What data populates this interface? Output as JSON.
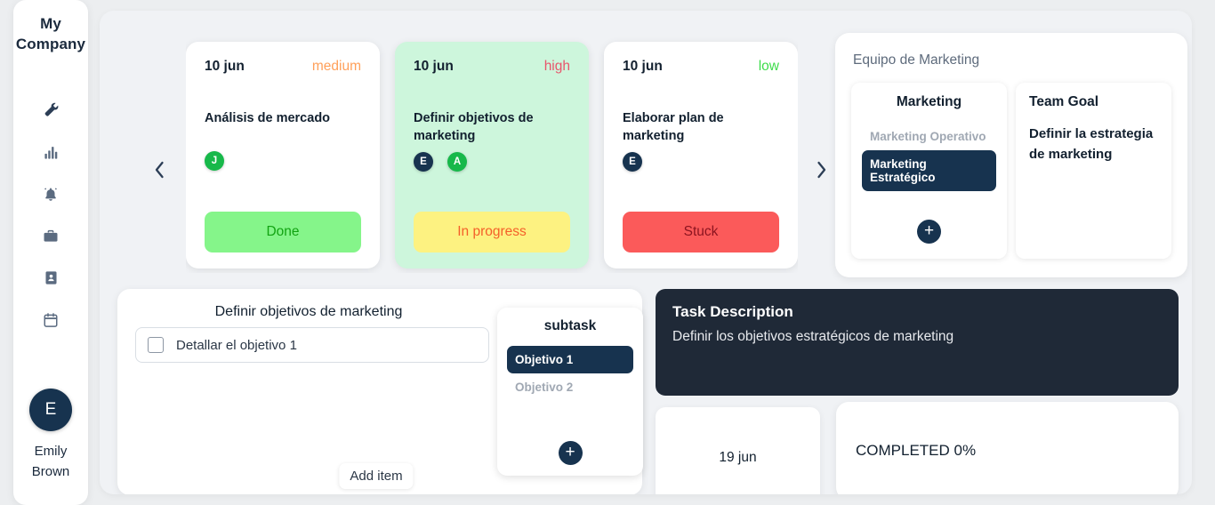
{
  "sidebar": {
    "brand_line1": "My",
    "brand_line2": "Company",
    "icons": [
      {
        "name": "wrench-icon"
      },
      {
        "name": "bar-chart-icon"
      },
      {
        "name": "bell-icon"
      },
      {
        "name": "briefcase-icon"
      },
      {
        "name": "contact-card-icon"
      },
      {
        "name": "calendar-icon"
      }
    ],
    "user": {
      "avatar_initial": "E",
      "name_line1": "Emily",
      "name_line2": "Brown"
    }
  },
  "carousel": {
    "prev_label": "‹",
    "next_label": "›",
    "cards": [
      {
        "date": "10 jun",
        "priority": "medium",
        "priority_color": "#ffa05a",
        "title": "Análisis de mercado",
        "avatars": [
          {
            "initial": "J",
            "color": "#17b84a"
          }
        ],
        "status": "Done",
        "status_bg": "#85f58a",
        "status_fg": "#12a312",
        "highlighted": false
      },
      {
        "date": "10 jun",
        "priority": "high",
        "priority_color": "#e8556b",
        "title": "Definir objetivos de marketing",
        "avatars": [
          {
            "initial": "E",
            "color": "#17334f"
          },
          {
            "initial": "A",
            "color": "#17b84a"
          }
        ],
        "status": "In progress",
        "status_bg": "#fdf281",
        "status_fg": "#f4602a",
        "highlighted": true
      },
      {
        "date": "10 jun",
        "priority": "low",
        "priority_color": "#3ddc4a",
        "title": "Elaborar plan de marketing",
        "avatars": [
          {
            "initial": "E",
            "color": "#17334f"
          }
        ],
        "status": "Stuck",
        "status_bg": "#fb5a5a",
        "status_fg": "#8c1420",
        "highlighted": false
      }
    ]
  },
  "team_panel": {
    "title": "Equipo de Marketing",
    "marketing_column": {
      "title": "Marketing",
      "items": [
        {
          "label": "Marketing Operativo",
          "active": false
        },
        {
          "label": "Marketing Estratégico",
          "active": true
        }
      ],
      "add_label": "+"
    },
    "goal_column": {
      "title": "Team Goal",
      "text": "Definir la estrategia de marketing"
    }
  },
  "checklist": {
    "title": "Definir objetivos de marketing",
    "items": [
      {
        "label": "Detallar el objetivo 1",
        "checked": false
      }
    ],
    "add_item_label": "Add item"
  },
  "subtask": {
    "title": "subtask",
    "items": [
      {
        "label": "Objetivo 1",
        "active": true
      },
      {
        "label": "Objetivo 2",
        "active": false
      }
    ],
    "add_label": "+"
  },
  "description": {
    "title": "Task Description",
    "body": "Definir los objetivos estratégicos de marketing"
  },
  "bottom": {
    "due_date": "19 jun",
    "completed_label": "COMPLETED 0%"
  }
}
